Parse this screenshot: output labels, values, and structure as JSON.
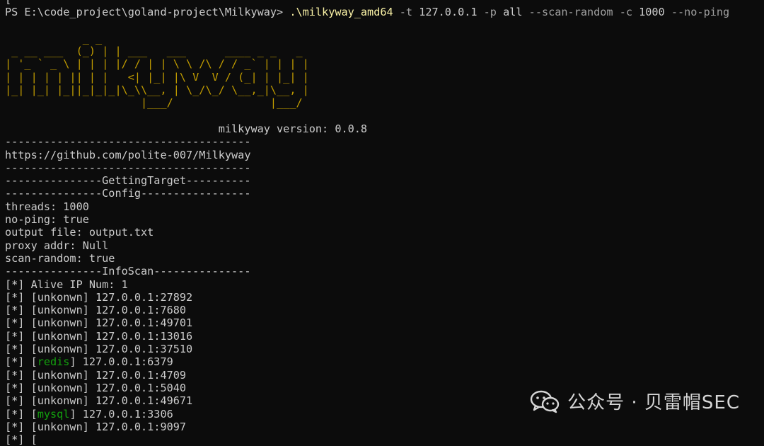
{
  "prompt": {
    "prefix": "PS E:\\code_project\\goland-project\\Milkyway> ",
    "executable": ".\\milkyway_amd64",
    "flag_t": " -t",
    "target": " 127.0.0.1",
    "flag_p": " -p",
    "ports": " all",
    "flag_scan_random": " --scan-random",
    "flag_c": " -c",
    "threads_value": " 1000",
    "flag_no_ping": " --no-ping"
  },
  "banner": [
    "            _ _",
    " _ __ ___  (_) | | ___   ___      ____ _ _   _",
    "| '_ ` _ \\ | | | |/ / | | \\ \\ /\\ / / _` | | | |",
    "| | | | | || | |   <| |_| |\\ V  V / (_| | |_| |",
    "|_| |_| |_||_|_|_|\\_\\\\__, | \\_/\\_/ \\__,_|\\__, |",
    "                     |___/               |___/"
  ],
  "version": "                                 milkyway version: 0.0.8",
  "divider_long": "--------------------------------------",
  "repo_url": "https://github.com/polite-007/Milkyway",
  "section_target": "---------------GettingTarget----------",
  "section_config": "---------------Config-----------------",
  "config": {
    "threads": "threads: 1000",
    "no_ping": "no-ping: true",
    "output_file": "output file: output.txt",
    "proxy_addr": "proxy addr: Null",
    "scan_random": "scan-random: true"
  },
  "section_infoscan": "---------------InfoScan---------------",
  "alive_line": "[*] Alive IP Num: 1",
  "results": [
    {
      "prefix": "[*] [",
      "service": "unkonwn",
      "suffix": "] 127.0.0.1:27892",
      "highlight": false
    },
    {
      "prefix": "[*] [",
      "service": "unkonwn",
      "suffix": "] 127.0.0.1:7680",
      "highlight": false
    },
    {
      "prefix": "[*] [",
      "service": "unkonwn",
      "suffix": "] 127.0.0.1:49701",
      "highlight": false
    },
    {
      "prefix": "[*] [",
      "service": "unkonwn",
      "suffix": "] 127.0.0.1:13016",
      "highlight": false
    },
    {
      "prefix": "[*] [",
      "service": "unkonwn",
      "suffix": "] 127.0.0.1:37510",
      "highlight": false
    },
    {
      "prefix": "[*] [",
      "service": "redis",
      "suffix": "] 127.0.0.1:6379",
      "highlight": true
    },
    {
      "prefix": "[*] [",
      "service": "unkonwn",
      "suffix": "] 127.0.0.1:4709",
      "highlight": false
    },
    {
      "prefix": "[*] [",
      "service": "unkonwn",
      "suffix": "] 127.0.0.1:5040",
      "highlight": false
    },
    {
      "prefix": "[*] [",
      "service": "unkonwn",
      "suffix": "] 127.0.0.1:49671",
      "highlight": false
    },
    {
      "prefix": "[*] [",
      "service": "mysql",
      "suffix": "] 127.0.0.1:3306",
      "highlight": true
    },
    {
      "prefix": "[*] [",
      "service": "unkonwn",
      "suffix": "] 127.0.0.1:9097",
      "highlight": false
    },
    {
      "prefix": "[*] [",
      "service": "",
      "suffix": "",
      "highlight": false
    }
  ],
  "watermark": {
    "text": "公众号 · 贝雷帽SEC",
    "icon": "wechat-icon"
  },
  "colors": {
    "background": "#0c0c0c",
    "text": "#cccccc",
    "banner": "#c19c00",
    "executable": "#f9f1a5",
    "service_highlight": "#13a10e"
  }
}
